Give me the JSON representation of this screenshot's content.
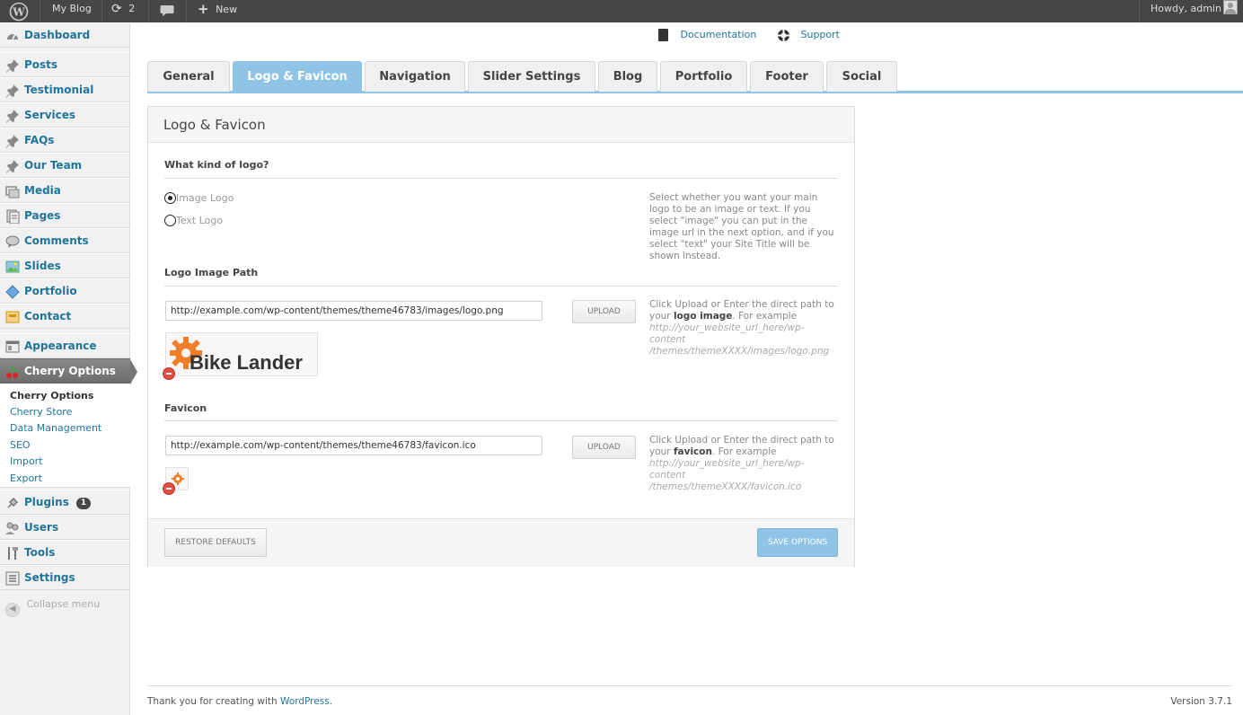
{
  "adminbar": {
    "site_name": "My Blog",
    "updates_count": "2",
    "new_label": "New",
    "howdy": "Howdy, admin"
  },
  "sidebar": {
    "items": [
      {
        "label": "Dashboard"
      },
      {
        "label": "Posts"
      },
      {
        "label": "Testimonial"
      },
      {
        "label": "Services"
      },
      {
        "label": "FAQs"
      },
      {
        "label": "Our Team"
      },
      {
        "label": "Media"
      },
      {
        "label": "Pages"
      },
      {
        "label": "Comments"
      },
      {
        "label": "Slides"
      },
      {
        "label": "Portfolio"
      },
      {
        "label": "Contact"
      },
      {
        "label": "Appearance"
      },
      {
        "label": "Cherry Options"
      },
      {
        "label": "Plugins",
        "badge": "1"
      },
      {
        "label": "Users"
      },
      {
        "label": "Tools"
      },
      {
        "label": "Settings"
      }
    ],
    "submenu": [
      "Cherry Options",
      "Cherry Store",
      "Data Management",
      "SEO",
      "Import",
      "Export"
    ],
    "collapse": "Collapse menu"
  },
  "help": {
    "documentation": "Documentation",
    "support": "Support"
  },
  "tabs": [
    "General",
    "Logo & Favicon",
    "Navigation",
    "Slider Settings",
    "Blog",
    "Portfolio",
    "Footer",
    "Social"
  ],
  "panel": {
    "title": "Logo & Favicon",
    "logo_kind": {
      "title": "What kind of logo?",
      "options": [
        "Image Logo",
        "Text Logo"
      ],
      "selected": "Image Logo",
      "desc": "Select whether you want your main logo to be an image or text. If you select \"image\" you can put in the image url in the next option, and if you select \"text\" your Site Title will be shown instead."
    },
    "logo_path": {
      "title": "Logo Image Path",
      "value": "http://example.com/wp-content/themes/theme46783/images/logo.png",
      "upload": "UPLOAD",
      "desc_pre": "Click Upload or Enter the direct path to your ",
      "desc_bold": "logo image",
      "desc_post": ". For example",
      "example1": "http://your_website_url_here/wp-content",
      "example2": "/themes/themeXXXX/images/logo.png",
      "logo_text": "Bike Lander"
    },
    "favicon": {
      "title": "Favicon",
      "value": "http://example.com/wp-content/themes/theme46783/favicon.ico",
      "upload": "UPLOAD",
      "desc_pre": "Click Upload or Enter the direct path to your ",
      "desc_bold": "favicon",
      "desc_post": ". For example",
      "example1": "http://your_website_url_here/wp-content",
      "example2": "/themes/themeXXXX/favicon.ico"
    },
    "restore": "RESTORE DEFAULTS",
    "save": "SAVE OPTIONS"
  },
  "footer": {
    "thanks_pre": "Thank you for creating with ",
    "thanks_link": "WordPress",
    "thanks_post": ".",
    "version": "Version 3.7.1"
  },
  "colors": {
    "accent": "#8fc4e6",
    "link": "#21759b",
    "adminbar": "#464646",
    "logo_orange": "#f07e2b"
  }
}
